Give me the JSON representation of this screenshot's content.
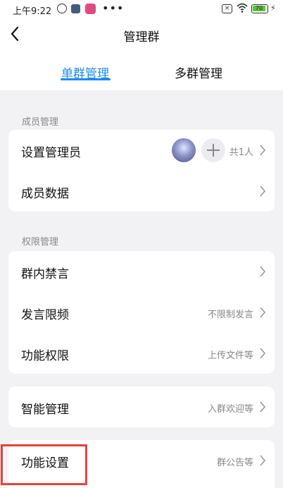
{
  "status_bar": {
    "time": "上午9:22",
    "battery": "70"
  },
  "header": {
    "title": "管理群"
  },
  "tabs": [
    {
      "label": "单群管理",
      "active": true
    },
    {
      "label": "多群管理",
      "active": false
    }
  ],
  "sections": {
    "member": {
      "title": "成员管理",
      "rows": [
        {
          "label": "设置管理员",
          "value": "共1人"
        },
        {
          "label": "成员数据",
          "value": ""
        }
      ]
    },
    "permission": {
      "title": "权限管理",
      "rows": [
        {
          "label": "群内禁言",
          "value": ""
        },
        {
          "label": "发言限频",
          "value": "不限制发言"
        },
        {
          "label": "功能权限",
          "value": "上传文件等"
        }
      ]
    },
    "smart": {
      "rows": [
        {
          "label": "智能管理",
          "value": "入群欢迎等"
        }
      ]
    },
    "function": {
      "rows": [
        {
          "label": "功能设置",
          "value": "群公告等"
        }
      ]
    }
  },
  "colors": {
    "accent": "#1a8cf0",
    "highlight_box": "#e8413a"
  }
}
